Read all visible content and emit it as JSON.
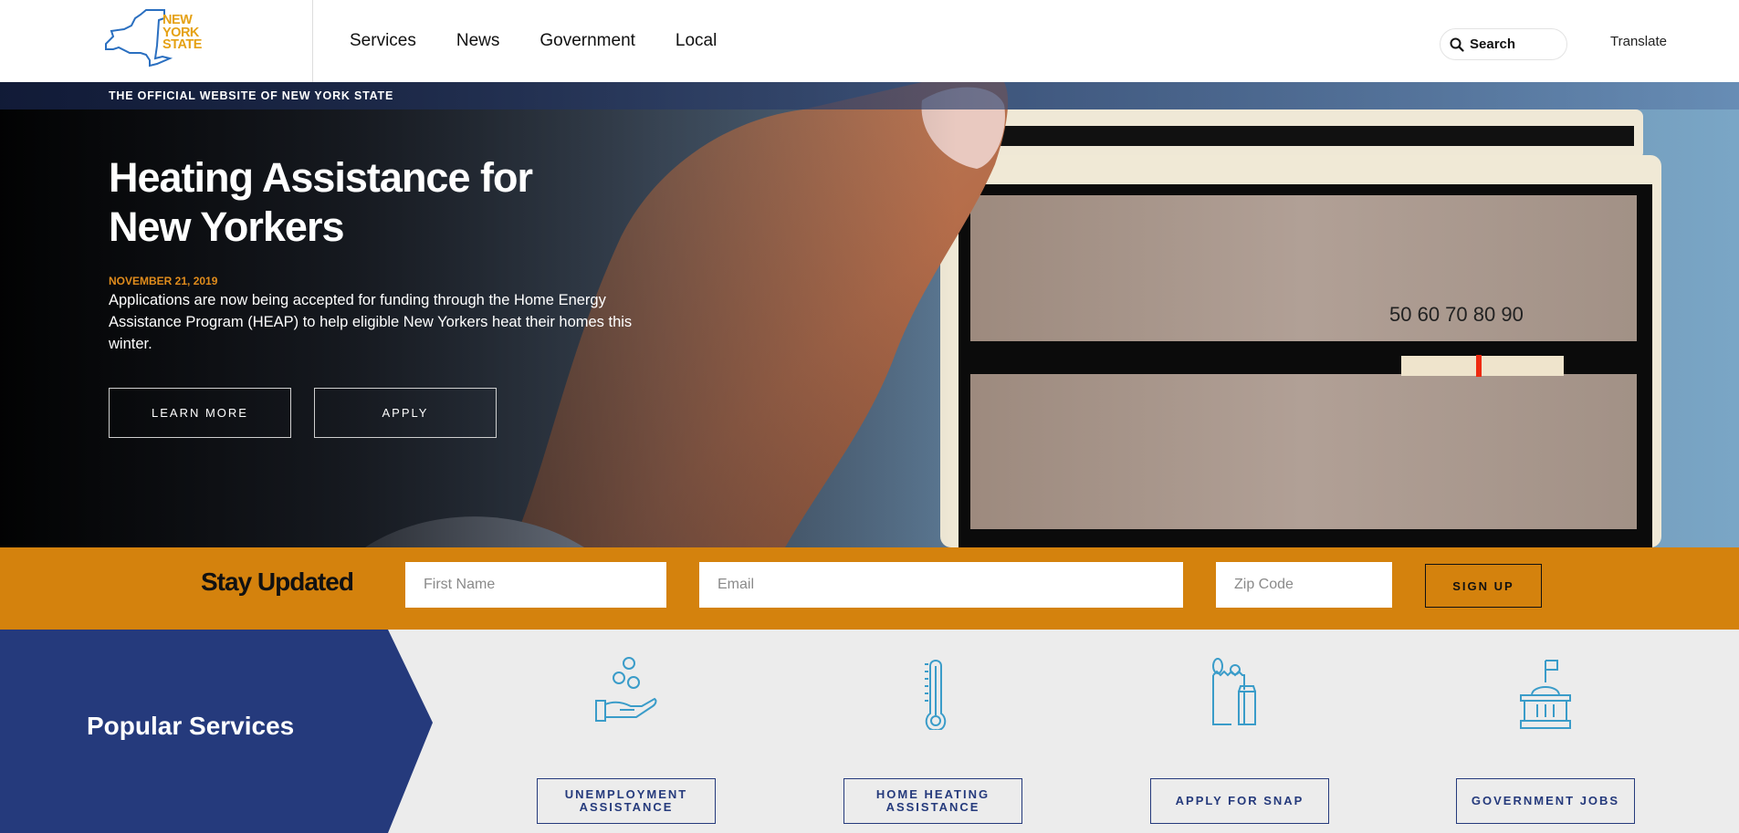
{
  "header": {
    "logo": {
      "lines": [
        "NEW",
        "YORK",
        "STATE"
      ],
      "icon": "ny-state-outline-icon"
    },
    "nav": [
      {
        "label": "Services"
      },
      {
        "label": "News"
      },
      {
        "label": "Government"
      },
      {
        "label": "Local"
      }
    ],
    "search": {
      "label": "Search",
      "icon": "search-icon"
    },
    "translate_label": "Translate"
  },
  "hero": {
    "official_text": "THE OFFICIAL WEBSITE OF NEW YORK STATE",
    "title": "Heating Assistance for New Yorkers",
    "date": "NOVEMBER 21, 2019",
    "description": "Applications are now being accepted for funding through the Home Energy Assistance Program (HEAP) to help eligible New Yorkers heat their homes this winter.",
    "buttons": {
      "learn_more": "LEARN MORE",
      "apply": "APPLY"
    },
    "image": {
      "subject": "hand adjusting thermostat",
      "thermostat_scale": [
        "50",
        "60",
        "70",
        "80",
        "90"
      ]
    }
  },
  "stay_updated": {
    "title": "Stay Updated",
    "first_name_placeholder": "First Name",
    "email_placeholder": "Email",
    "zip_placeholder": "Zip Code",
    "signup_label": "SIGN UP"
  },
  "popular_services": {
    "title": "Popular Services",
    "items": [
      {
        "label": "UNEMPLOYMENT ASSISTANCE",
        "icon": "hand-coins-icon"
      },
      {
        "label": "HOME HEATING ASSISTANCE",
        "icon": "thermometer-icon"
      },
      {
        "label": "APPLY FOR SNAP",
        "icon": "grocery-bag-icon"
      },
      {
        "label": "GOVERNMENT JOBS",
        "icon": "capitol-building-icon"
      }
    ]
  },
  "colors": {
    "accent_orange": "#d4820d",
    "navy": "#253a7c",
    "logo_gold": "#e5a114",
    "icon_blue": "#3a9cc9"
  }
}
